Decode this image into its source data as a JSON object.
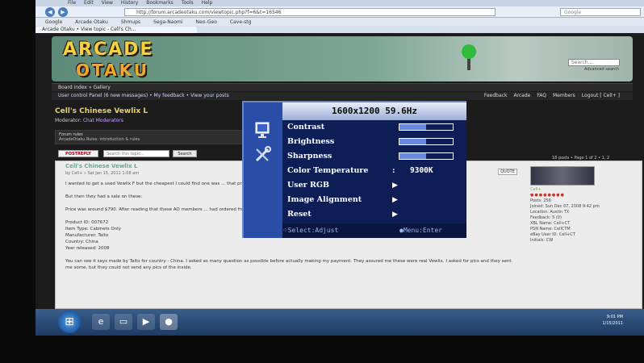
{
  "browser": {
    "menu": [
      "File",
      "Edit",
      "View",
      "History",
      "Bookmarks",
      "Tools",
      "Help"
    ],
    "url": "http://forum.arcadeotaku.com/viewtopic.php?f=6&t=16546",
    "bookmarks": [
      "Google",
      "Arcade Otaku",
      "Shmups",
      "Sega-Naomi",
      "Neo-Geo",
      "Cave-stg"
    ],
    "tab_title": "Arcade Otaku • View topic - Cell's Ch..."
  },
  "forum": {
    "logo_top": "ARCADE",
    "logo_bottom": "OTAKU",
    "search_placeholder": "Search...",
    "advanced_search": "Advanced search",
    "breadcrumb": "Board index » Gallery",
    "user_links": "User control Panel (6 new messages) • My feedback • View your posts",
    "right_links": [
      "Feedback",
      "Arcade",
      "FAQ",
      "Members",
      "Logout [ Cell+ ]"
    ],
    "topic_title": "Cell's Chinese Vewlix L",
    "moderator_label": "Moderator:",
    "moderator_name": "Chat Moderators",
    "rules_title": "Forum rules",
    "rules_text": "ArcadeOtaku Rules: introduction & rules",
    "postreply": "POSTREPLY",
    "topic_search_placeholder": "Search this topic...",
    "search_button": "Search",
    "pagination": "18 posts • Page 1 of 2 • 1, 2",
    "post": {
      "subject": "Cell's Chinese Vewlix L",
      "meta": "by Cell+ » Sat Jan 15, 2011 1:08 am",
      "quote": "QUOTE",
      "p1": "I wanted to get a used Vewlix F but the cheapest I could find one was ... that price. So I found this deal at Cotinap.",
      "p2": "But then they had a sale on these:",
      "p3": "Price was around $790. After reading that these AO members ... had ordered from Cotinap and were happy with their purchases, I decided to order the L listed above.",
      "specs": [
        "Product ID: 007672",
        "Item Type: Cabinets Only",
        "Manufacturer: Taito",
        "Country: China",
        "Year released: 2008"
      ],
      "p4": "You can see it says made by Taito for country - China. I asked as many question as possible before actually making my payment. They assured me these were real Vewlix. I asked for pics and they sent me some, but they could not send any pics of the inside."
    },
    "profile": {
      "name": "Cell+",
      "posts": "Posts: 256",
      "joined": "Joined: Sun Dec 07, 2008 9:42 pm",
      "location": "Location: Austin TX",
      "feedback": "Feedback: 5 (0)",
      "xbl": "XBL Name: Cell+CT",
      "psn": "PSN Name: CellCTM",
      "ebay": "eBay User ID: Cell+CT",
      "initials": "Initials: CW"
    }
  },
  "taskbar": {
    "start": "⊞",
    "time": "9:01 PM",
    "date": "1/15/2011"
  },
  "osd": {
    "resolution": "1600x1200  59.6Hz",
    "items": [
      {
        "label": "Contrast",
        "kind": "bar",
        "level": 0.5
      },
      {
        "label": "Brightness",
        "kind": "bar",
        "level": 0.5
      },
      {
        "label": "Sharpness",
        "kind": "bar",
        "level": 0.5
      },
      {
        "label": "Color Temperature",
        "kind": "value",
        "value": "9300K"
      },
      {
        "label": "User RGB",
        "kind": "arrow"
      },
      {
        "label": "Image Alignment",
        "kind": "arrow"
      },
      {
        "label": "Reset",
        "kind": "arrow"
      }
    ],
    "colon": ":",
    "arrow": "▶",
    "footer_adjust": "Select:Adjust",
    "footer_enter": "Menu:Enter",
    "icons": [
      "monitor-icon",
      "tools-icon"
    ]
  },
  "colors": {
    "osd_bg": "#0d1e57",
    "osd_accent": "#6a8ae0",
    "title_gold": "#e8d36a"
  }
}
